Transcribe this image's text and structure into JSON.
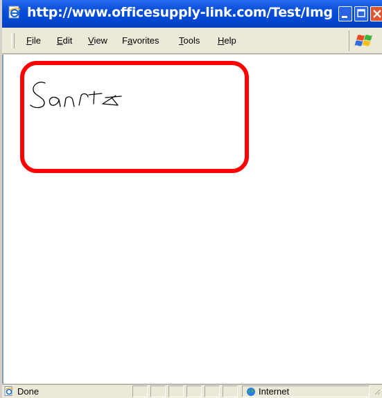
{
  "window": {
    "title": "http://www.officesupply-link.com/Test/Imgs/Sign..."
  },
  "menu": {
    "items": [
      {
        "accel": "F",
        "rest": "ile"
      },
      {
        "accel": "E",
        "rest": "dit"
      },
      {
        "accel": "V",
        "rest": "iew"
      },
      {
        "pre": "F",
        "accel": "a",
        "rest": "vorites"
      },
      {
        "accel": "T",
        "rest": "ools"
      },
      {
        "accel": "H",
        "rest": "elp"
      }
    ]
  },
  "content": {
    "signature_text": "Santa",
    "highlight_color": "#ff0000"
  },
  "status": {
    "text": "Done",
    "zone": "Internet"
  },
  "colors": {
    "titlebar": "#0348d4",
    "close_button": "#e2532f",
    "chrome": "#ece9d8"
  },
  "icons": [
    "ie-page-icon",
    "minimize-icon",
    "maximize-icon",
    "close-icon",
    "windows-logo-icon",
    "internet-globe-icon"
  ]
}
